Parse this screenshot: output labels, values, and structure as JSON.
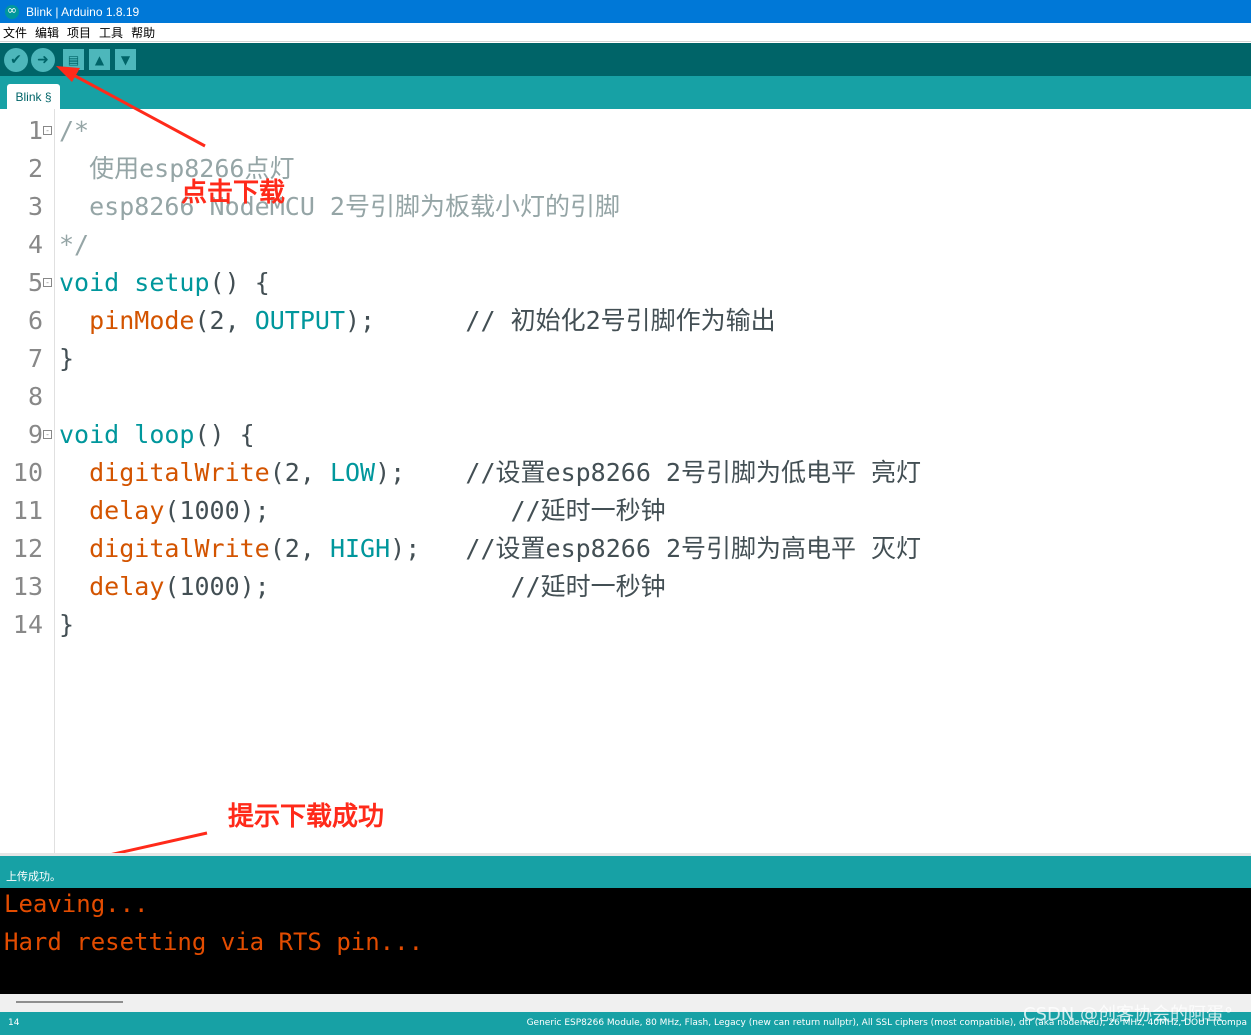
{
  "window": {
    "title": "Blink | Arduino 1.8.19",
    "app_icon": "arduino-icon"
  },
  "menu": [
    "文件",
    "编辑",
    "项目",
    "工具",
    "帮助"
  ],
  "toolbar": {
    "verify_icon": "checkmark-icon",
    "upload_icon": "arrow-right-icon",
    "new_icon": "new-file-icon",
    "open_icon": "open-arrow-up-icon",
    "save_icon": "save-arrow-down-icon"
  },
  "tab": {
    "label": "Blink §"
  },
  "code_lines": [
    {
      "n": "1",
      "fold": "⊟",
      "text": "/*"
    },
    {
      "n": "2",
      "text": "  使用esp8266点灯"
    },
    {
      "n": "3",
      "text": "  esp8266 NodeMCU 2号引脚为板载小灯的引脚"
    },
    {
      "n": "4",
      "text": "*/"
    },
    {
      "n": "5",
      "fold": "⊟",
      "kw": "void",
      "fn": "setup",
      "rest": "() {"
    },
    {
      "n": "6",
      "fn": "pinMode",
      "a": "(2, ",
      "cst": "OUTPUT",
      "b": ");      // 初始化2号引脚作为输出"
    },
    {
      "n": "7",
      "text": "}"
    },
    {
      "n": "8",
      "text": ""
    },
    {
      "n": "9",
      "fold": "⊟",
      "kw": "void",
      "fn": "loop",
      "rest": "() {"
    },
    {
      "n": "10",
      "fn": "digitalWrite",
      "a": "(2, ",
      "cst": "LOW",
      "b": ");    //设置esp8266 2号引脚为低电平 亮灯"
    },
    {
      "n": "11",
      "fn": "delay",
      "a": "(1000);",
      "b": "                //延时一秒钟"
    },
    {
      "n": "12",
      "fn": "digitalWrite",
      "a": "(2, ",
      "cst": "HIGH",
      "b": ");   //设置esp8266 2号引脚为高电平 灭灯"
    },
    {
      "n": "13",
      "fn": "delay",
      "a": "(1000);",
      "b": "                //延时一秒钟"
    },
    {
      "n": "14",
      "text": "}"
    }
  ],
  "annotations": {
    "upload_hint": "点击下载",
    "success_hint": "提示下载成功"
  },
  "status": {
    "message": "上传成功。"
  },
  "console": [
    "Leaving...",
    "Hard resetting via RTS pin..."
  ],
  "footer": {
    "line_number": "14",
    "board": "Generic ESP8266 Module, 80 MHz, Flash, Legacy (new can return nullptr), All SSL ciphers (most compatible), dtr (aka nodemcu), 26 MHz, 40MHz, DOUT (compa"
  },
  "watermark": "CSDN @创客协会的阿蛋°",
  "colors": {
    "toolbar": "#006468",
    "teal": "#17a1a5",
    "keyword": "#00979c",
    "function": "#d35400",
    "comment": "#95a5a6",
    "console_text": "#e34c00",
    "annotation": "#ff2a1a"
  }
}
